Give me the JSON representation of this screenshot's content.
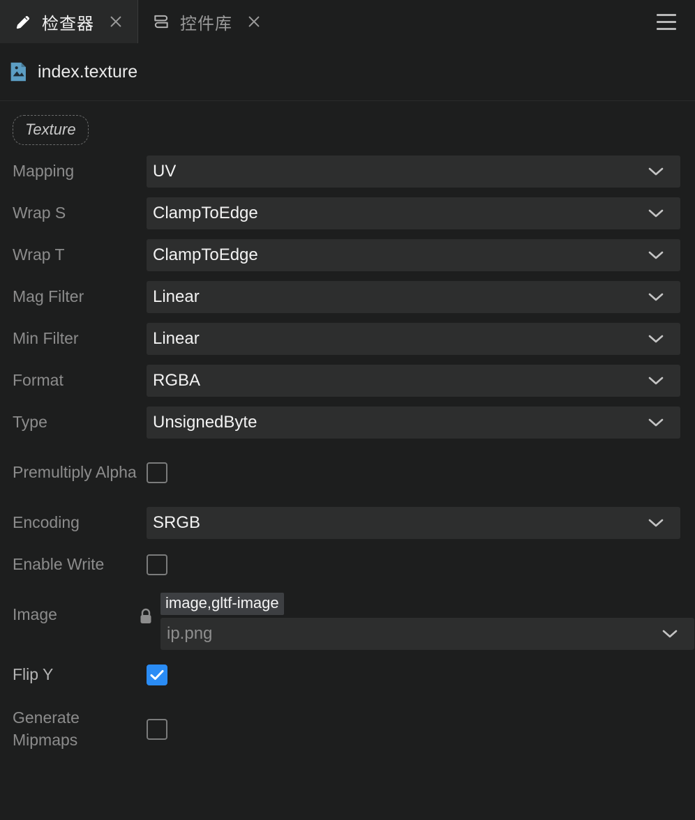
{
  "window": {
    "menu_icon": "hamburger-menu-icon"
  },
  "tabs": [
    {
      "label": "检查器",
      "icon": "pencil-icon",
      "close_icon": "close-icon",
      "active": true
    },
    {
      "label": "控件库",
      "icon": "books-icon",
      "close_icon": "close-icon",
      "active": false
    }
  ],
  "asset": {
    "icon": "image-file-icon",
    "name": "index.texture"
  },
  "section": {
    "badge": "Texture"
  },
  "properties": [
    {
      "label": "Mapping",
      "type": "select",
      "value": "UV",
      "icon": "chevron-down-icon"
    },
    {
      "label": "Wrap S",
      "type": "select",
      "value": "ClampToEdge",
      "icon": "chevron-down-icon"
    },
    {
      "label": "Wrap T",
      "type": "select",
      "value": "ClampToEdge",
      "icon": "chevron-down-icon"
    },
    {
      "label": "Mag Filter",
      "type": "select",
      "value": "Linear",
      "icon": "chevron-down-icon"
    },
    {
      "label": "Min Filter",
      "type": "select",
      "value": "Linear",
      "icon": "chevron-down-icon"
    },
    {
      "label": "Format",
      "type": "select",
      "value": "RGBA",
      "icon": "chevron-down-icon"
    },
    {
      "label": "Type",
      "type": "select",
      "value": "UnsignedByte",
      "icon": "chevron-down-icon"
    },
    {
      "label": "Premultiply Alpha",
      "type": "checkbox",
      "checked": false
    },
    {
      "label": "Encoding",
      "type": "select",
      "value": "SRGB",
      "icon": "chevron-down-icon"
    },
    {
      "label": "Enable Write",
      "type": "checkbox",
      "checked": false
    },
    {
      "label": "Image",
      "type": "asset",
      "value": "ip.png",
      "tag": "image,gltf-image",
      "locked": true,
      "lock_icon": "lock-icon",
      "icon": "chevron-down-icon"
    },
    {
      "label": "Flip Y",
      "type": "checkbox",
      "checked": true
    },
    {
      "label": "Generate Mipmaps",
      "type": "checkbox",
      "checked": false
    }
  ],
  "colors": {
    "background": "#1d1e1e",
    "field": "#2d2e2e",
    "accent": "#2a8cf5",
    "label": "#8c8c8c",
    "value": "#f2f2f2",
    "asset_icon": "#5c9ec4"
  }
}
